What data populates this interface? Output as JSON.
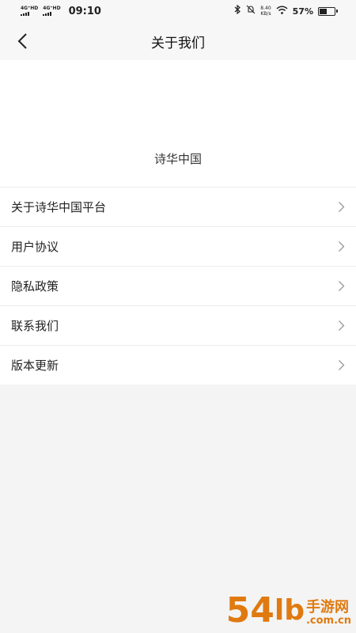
{
  "status_bar": {
    "network_1": "4G⁺HD",
    "network_2": "4G⁺HD",
    "time": "09:10",
    "speed_value": "8.40",
    "speed_unit": "KB/s",
    "battery_percent": "57%",
    "battery_level": 0.57
  },
  "nav": {
    "title": "关于我们"
  },
  "app": {
    "name": "诗华中国"
  },
  "menu": {
    "items": [
      {
        "label": "关于诗华中国平台"
      },
      {
        "label": "用户协议"
      },
      {
        "label": "隐私政策"
      },
      {
        "label": "联系我们"
      },
      {
        "label": "版本更新"
      }
    ]
  },
  "watermark": {
    "number": "54",
    "mid": "lb",
    "chinese": "手游网",
    "url": ".com.cn"
  },
  "colors": {
    "accent": "#e07a10",
    "background": "#f4f4f4",
    "surface": "#ffffff"
  }
}
